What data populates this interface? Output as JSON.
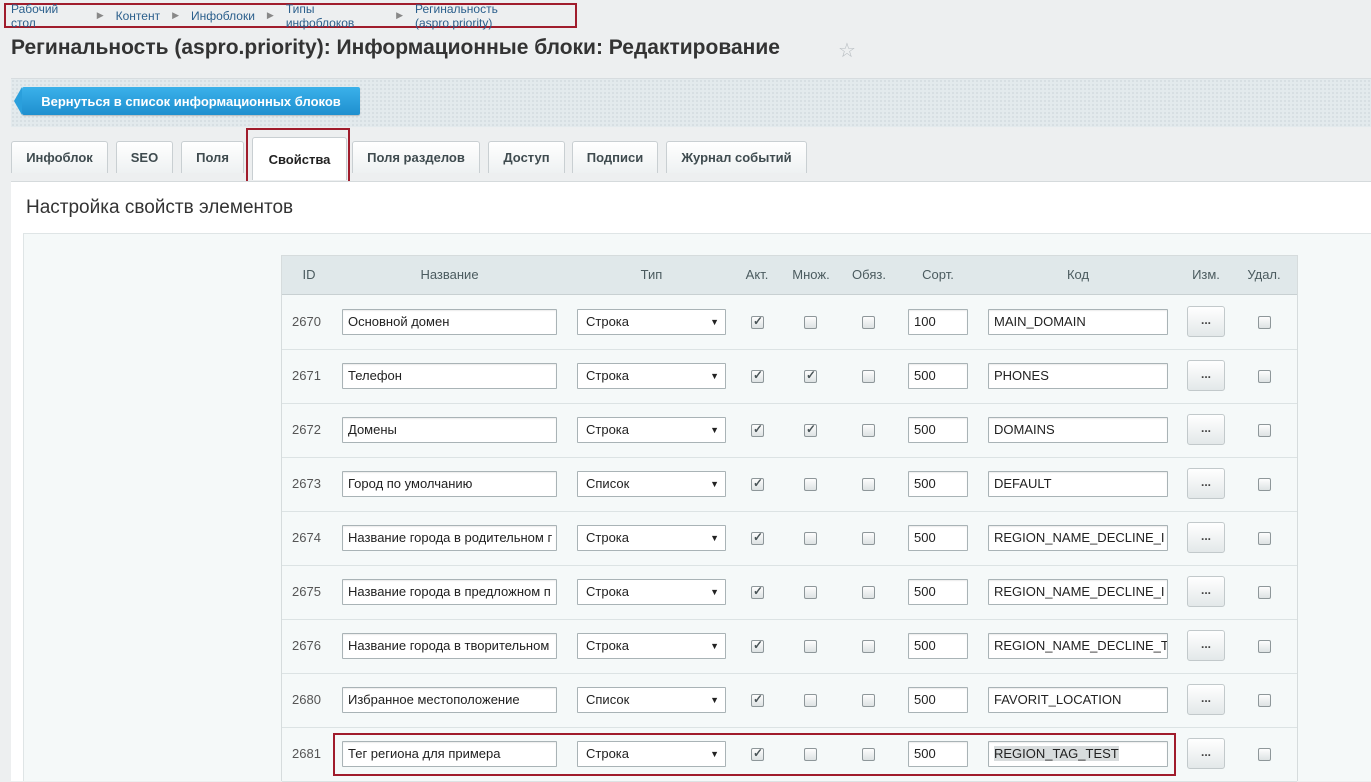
{
  "breadcrumbs": [
    "Рабочий стол",
    "Контент",
    "Инфоблоки",
    "Типы инфоблоков",
    "Регинальность (aspro.priority)"
  ],
  "title": "Регинальность (aspro.priority): Информационные блоки: Редактирование",
  "back_button": "Вернуться в список информационных блоков",
  "tabs": [
    "Инфоблок",
    "SEO",
    "Поля",
    "Свойства",
    "Поля разделов",
    "Доступ",
    "Подписи",
    "Журнал событий"
  ],
  "active_tab": "Свойства",
  "section_title": "Настройка свойств элементов",
  "table": {
    "headers": [
      "ID",
      "Название",
      "Тип",
      "Акт.",
      "Множ.",
      "Обяз.",
      "Сорт.",
      "Код",
      "Изм.",
      "Удал."
    ],
    "edit_label": "...",
    "rows": [
      {
        "id": "2670",
        "name": "Основной домен",
        "type": "Строка",
        "active": true,
        "multiple": false,
        "required": false,
        "sort": "100",
        "code": "MAIN_DOMAIN",
        "delete": false
      },
      {
        "id": "2671",
        "name": "Телефон",
        "type": "Строка",
        "active": true,
        "multiple": true,
        "required": false,
        "sort": "500",
        "code": "PHONES",
        "delete": false
      },
      {
        "id": "2672",
        "name": "Домены",
        "type": "Строка",
        "active": true,
        "multiple": true,
        "required": false,
        "sort": "500",
        "code": "DOMAINS",
        "delete": false
      },
      {
        "id": "2673",
        "name": "Город по умолчанию",
        "type": "Список",
        "active": true,
        "multiple": false,
        "required": false,
        "sort": "500",
        "code": "DEFAULT",
        "delete": false
      },
      {
        "id": "2674",
        "name": "Название города в родительном г",
        "type": "Строка",
        "active": true,
        "multiple": false,
        "required": false,
        "sort": "500",
        "code": "REGION_NAME_DECLINE_I",
        "delete": false
      },
      {
        "id": "2675",
        "name": "Название города в предложном п",
        "type": "Строка",
        "active": true,
        "multiple": false,
        "required": false,
        "sort": "500",
        "code": "REGION_NAME_DECLINE_I",
        "delete": false
      },
      {
        "id": "2676",
        "name": "Название города в творительном",
        "type": "Строка",
        "active": true,
        "multiple": false,
        "required": false,
        "sort": "500",
        "code": "REGION_NAME_DECLINE_T",
        "delete": false
      },
      {
        "id": "2680",
        "name": "Избранное местоположение",
        "type": "Список",
        "active": true,
        "multiple": false,
        "required": false,
        "sort": "500",
        "code": "FAVORIT_LOCATION",
        "delete": false
      },
      {
        "id": "2681",
        "name": "Тег региона для примера",
        "type": "Строка",
        "active": true,
        "multiple": false,
        "required": false,
        "sort": "500",
        "code": "REGION_TAG_TEST",
        "delete": false
      }
    ]
  },
  "colors": {
    "accent": "#2a9fdc",
    "highlight": "#a01c2c"
  }
}
